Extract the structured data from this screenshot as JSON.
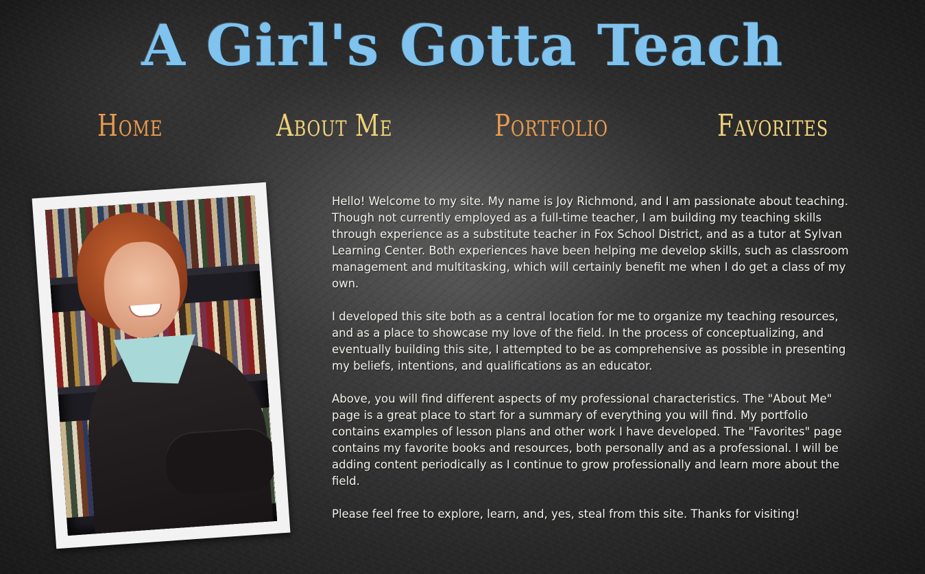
{
  "header": {
    "site_title": "A Girl's Gotta Teach"
  },
  "nav": {
    "home": "Home",
    "about": "About Me",
    "portfolio": "Portfolio",
    "favorites": "Favorites"
  },
  "colors": {
    "title": "#7fc3ee",
    "nav_orange": "#e89a4c",
    "nav_yellow": "#f0d179",
    "body_text": "#f4f1ea"
  },
  "photo": {
    "subject": "portrait of a smiling woman with red hair in front of bookshelves"
  },
  "intro": {
    "paragraphs": [
      "Hello! Welcome to my site. My name is Joy Richmond, and I am passionate about teaching. Though not currently employed as a full-time teacher, I am building my teaching skills through experience as a substitute teacher in Fox School District, and as a tutor at Sylvan Learning Center. Both experiences have been helping me develop skills, such as classroom management and multitasking, which will certainly benefit me when I do get a class of my own.",
      "I developed this site both as a central location for me to organize my teaching resources, and as a place to showcase my love of the field. In the process of conceptualizing, and eventually building this site, I attempted to be as comprehensive as possible in presenting my beliefs, intentions, and qualifications as an educator.",
      "Above, you will find different aspects of my professional characteristics. The \"About Me\" page is a great place to start for a summary of everything you will find. My portfolio contains examples of lesson plans and other work I have developed. The \"Favorites\" page contains my favorite books and resources, both personally and as a professional. I will be adding content periodically as I continue to grow professionally and learn more about the field.",
      "Please feel free to explore, learn, and, yes, steal from this site. Thanks for visiting!"
    ]
  }
}
